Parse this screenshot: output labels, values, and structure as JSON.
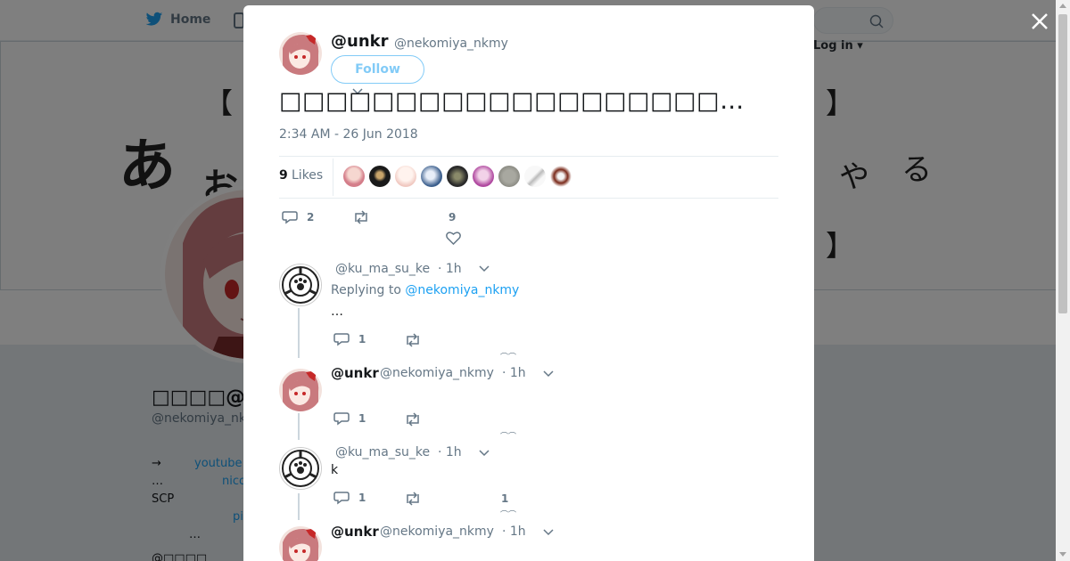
{
  "topbar": {
    "home_label": "Home",
    "login_label": "Log in"
  },
  "banner": {
    "bracket_open_1": "【",
    "bracket_close_1": "】",
    "brush_a": "あ",
    "brush_o": "お",
    "kana_ya": "や",
    "kana_ru": "る",
    "bracket_close_2": "】"
  },
  "profile": {
    "name": "□□□□@un",
    "handle": "@nekomiya_nk",
    "bio_lines": [
      "→",
      "…",
      "SCP"
    ],
    "bio_link_1": "youtube",
    "bio_link_2": "nico",
    "bio_link_3": "pi",
    "bio_more": "…",
    "bio_partial": "@□□□□"
  },
  "modal": {
    "author_name": "@unkr",
    "author_handle": "@nekomiya_nkmy",
    "follow_label": "Follow",
    "tweet_text": "□□□□□□□□□□□□□□□□□□□…",
    "timestamp": "2:34 AM - 26 Jun 2018",
    "likes_count": "9",
    "likes_label": "Likes",
    "actions": {
      "reply_count": "2",
      "like_count": "9"
    }
  },
  "replies": [
    {
      "handle": "@ku_ma_su_ke",
      "time": "· 1h",
      "replying_to_label": "Replying to",
      "replying_to_handle": "@nekomiya_nkmy",
      "text": "…",
      "reply_count": "1"
    },
    {
      "name": "@unkr",
      "handle": "@nekomiya_nkmy",
      "time": "· 1h",
      "reply_count": "1"
    },
    {
      "handle": "@ku_ma_su_ke",
      "time": "· 1h",
      "text": "k",
      "reply_count": "1",
      "like_count": "1"
    },
    {
      "name": "@unkr",
      "handle": "@nekomiya_nkmy",
      "time": "· 1h"
    }
  ],
  "colors": {
    "twitter_blue": "#1da1f2",
    "text_primary": "#14171a",
    "text_secondary": "#657786",
    "avatar_hair": "#c97a7e",
    "bow_red": "#c62828"
  },
  "icons": {
    "close": "close-icon",
    "reply": "reply-icon",
    "retweet": "retweet-icon",
    "like": "heart-icon",
    "caret": "chevron-down-icon",
    "search": "search-icon",
    "twitter": "twitter-bird-icon"
  }
}
